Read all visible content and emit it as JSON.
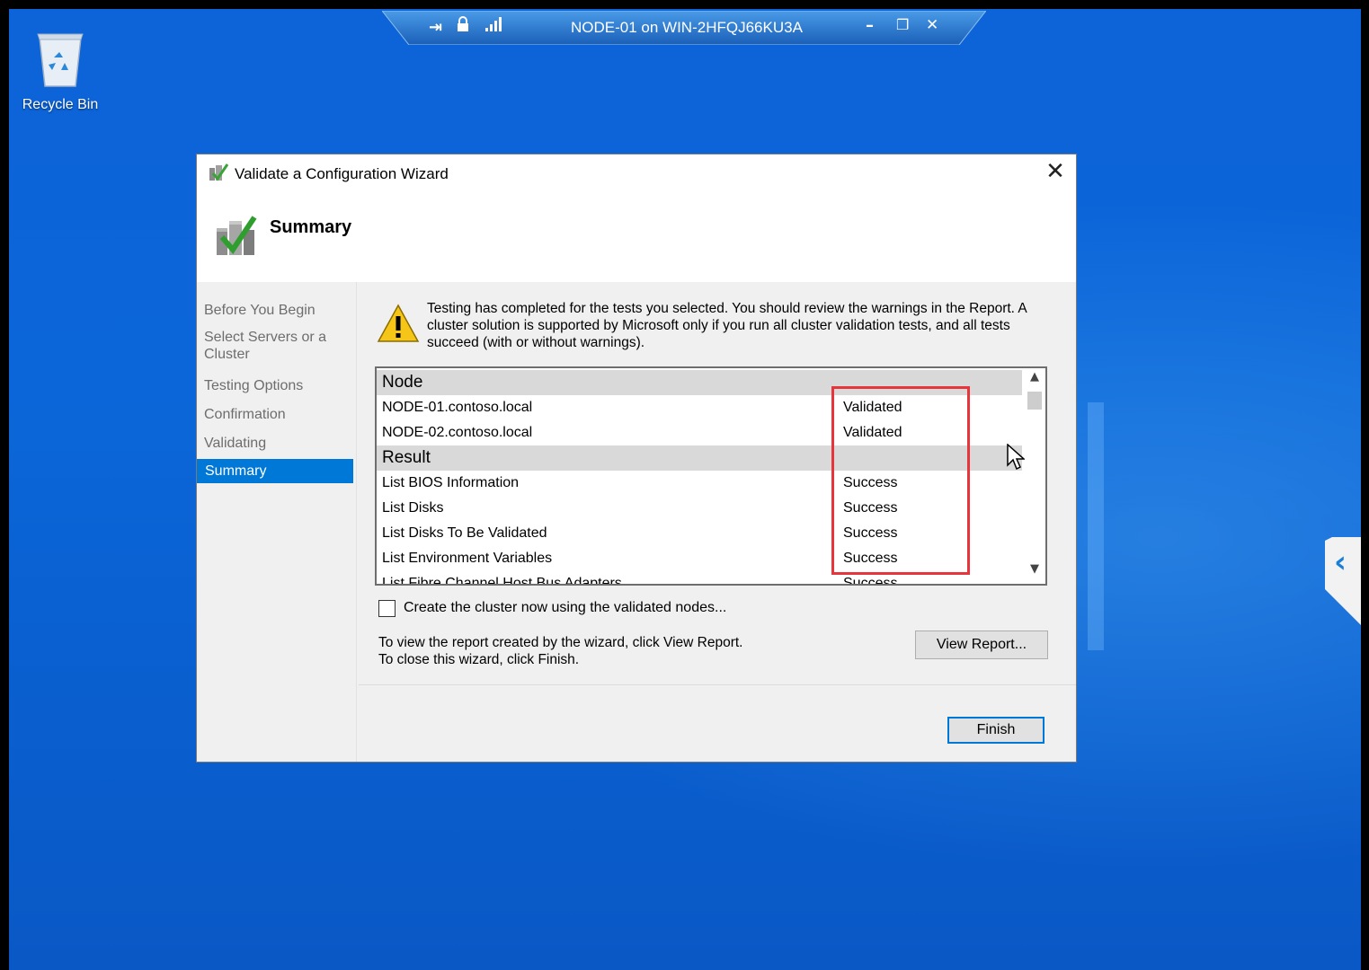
{
  "desktop": {
    "recycle_bin_label": "Recycle Bin"
  },
  "rdp_bar": {
    "title": "NODE-01 on WIN-2HFQJ66KU3A",
    "pin_icon": "⇥",
    "lock_icon": "lock",
    "signal_icon": "signal",
    "minimize": "–",
    "restore": "❐",
    "close": "✕"
  },
  "dialog": {
    "title": "Validate a Configuration Wizard",
    "header": "Summary",
    "close_glyph": "✕",
    "nav": [
      {
        "label": "Before You Begin"
      },
      {
        "label": "Select Servers or a Cluster"
      },
      {
        "label": "Testing Options"
      },
      {
        "label": "Confirmation"
      },
      {
        "label": "Validating"
      },
      {
        "label": "Summary"
      }
    ],
    "warning_text": "Testing has completed for the tests you selected. You should review the warnings in the Report.  A cluster solution is supported by Microsoft only if you run all cluster validation tests, and all tests succeed (with or without warnings).",
    "results": {
      "node_header": "Node",
      "nodes": [
        {
          "name": "NODE-01.contoso.local",
          "status": "Validated"
        },
        {
          "name": "NODE-02.contoso.local",
          "status": "Validated"
        }
      ],
      "result_header": "Result",
      "tests": [
        {
          "name": "List BIOS Information",
          "status": "Success"
        },
        {
          "name": "List Disks",
          "status": "Success"
        },
        {
          "name": "List Disks To Be Validated",
          "status": "Success"
        },
        {
          "name": "List Environment Variables",
          "status": "Success"
        },
        {
          "name": "List Fibre Channel Host Bus Adapters",
          "status": "Success"
        }
      ],
      "scroll_up": "▲",
      "scroll_down": "▼"
    },
    "checkbox_label": "Create the cluster now using the validated nodes...",
    "info_line1": "To view the report created by the wizard, click View Report.",
    "info_line2": "To close this wizard, click Finish.",
    "view_report_button": "View Report...",
    "finish_button": "Finish"
  },
  "colors": {
    "accent": "#0078d7",
    "highlight": "#e8343b",
    "desktop": "#0b63d6"
  }
}
